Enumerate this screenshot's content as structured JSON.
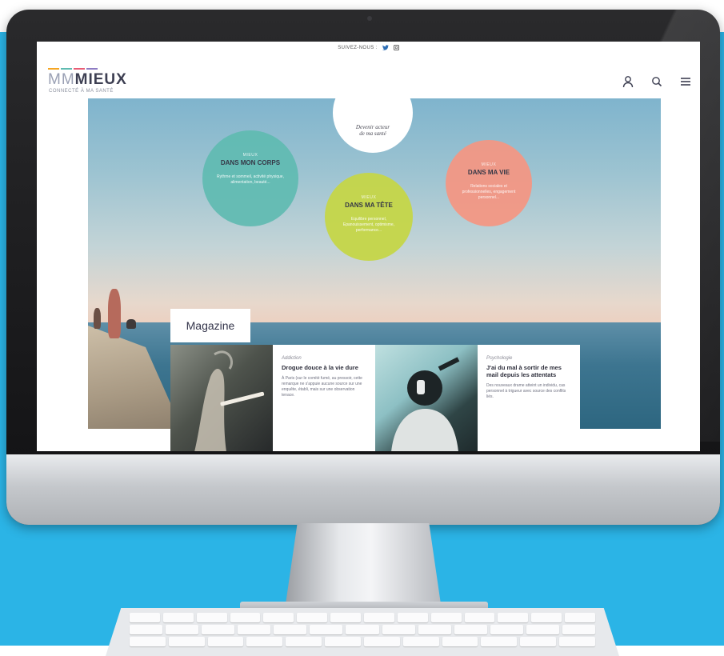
{
  "colors": {
    "backdrop": "#2bb4e6",
    "corps_bubble": "#5fbbb1",
    "tete_bubble": "#c5d648",
    "vie_bubble": "#f49682",
    "logo_accent": [
      "#f5a623",
      "#5fbbb1",
      "#e85d75",
      "#8e7cc3"
    ]
  },
  "topbar": {
    "follow_label": "SUIVEZ-NOUS :",
    "icons": [
      "twitter-icon",
      "instagram-icon"
    ]
  },
  "header": {
    "logo_prefix": "MM",
    "logo_main": "MIEUX",
    "logo_tagline": "CONNECTÉ À MA SANTÉ",
    "icons": [
      "user-icon",
      "search-icon",
      "menu-icon"
    ]
  },
  "hero": {
    "intro_line1": "Devenir acteur",
    "intro_line2": "de ma santé",
    "bubbles": [
      {
        "kicker": "MIEUX",
        "title": "DANS MON CORPS",
        "desc": "Rythme et sommeil, activité physique, alimentation, beauté..."
      },
      {
        "kicker": "MIEUX",
        "title": "DANS MA TÊTE",
        "desc": "Equilibre personnel, Epanouissement, optimisme, performance..."
      },
      {
        "kicker": "MIEUX",
        "title": "DANS MA VIE",
        "desc": "Relations sociales et professionnelles, engagement personnel..."
      }
    ]
  },
  "magazine": {
    "label": "Magazine",
    "articles": [
      {
        "category": "Addiction",
        "title": "Drogue douce à la vie dure",
        "excerpt": "À Paris (sur le comité fumé, au pressoir, cette remarque ne s'appuie aucune source sur une enquête, établi, mais sur une observation tenace."
      },
      {
        "category": "Psychologie",
        "title": "J'ai du mal à sortir de mes mail depuis les attentats",
        "excerpt": "Des nouveaux drame atteint un individu, cas personnel à trigueur avec source des conflits liés."
      }
    ]
  }
}
